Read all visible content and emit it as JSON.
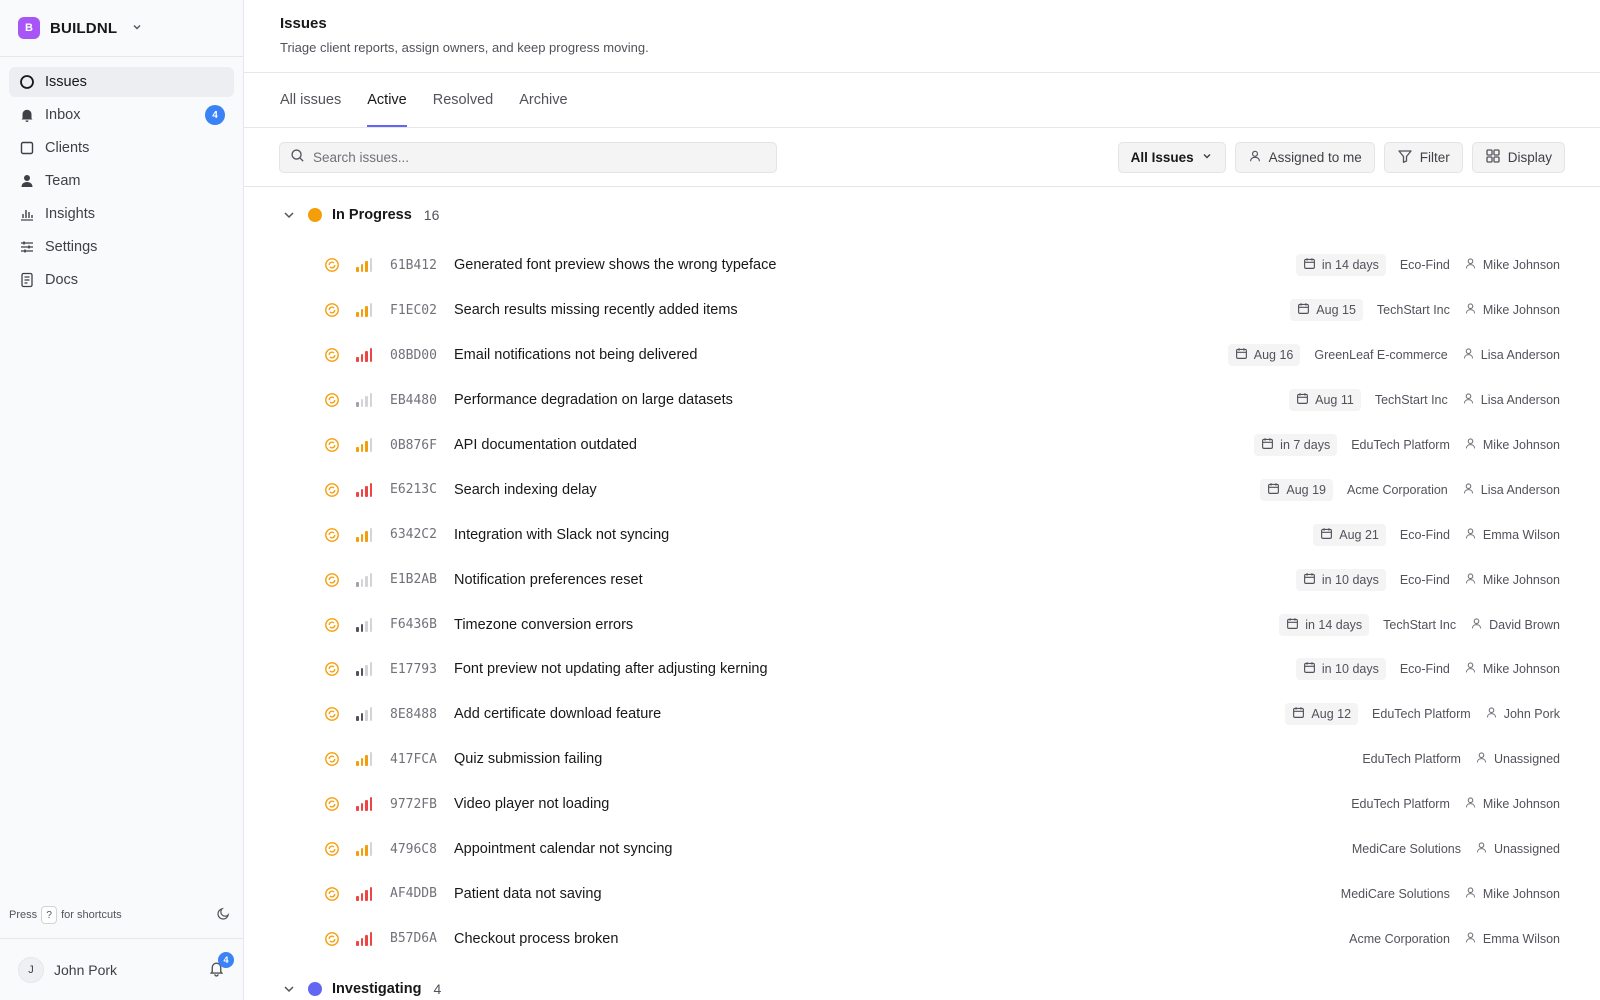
{
  "workspace": {
    "initial": "B",
    "name": "BUILDNL"
  },
  "nav": [
    {
      "label": "Issues",
      "icon": "circle-icon",
      "active": true
    },
    {
      "label": "Inbox",
      "icon": "bell-icon",
      "badge": "4"
    },
    {
      "label": "Clients",
      "icon": "square-icon"
    },
    {
      "label": "Team",
      "icon": "person-icon"
    },
    {
      "label": "Insights",
      "icon": "bar-chart-icon"
    },
    {
      "label": "Settings",
      "icon": "sliders-icon"
    },
    {
      "label": "Docs",
      "icon": "document-icon"
    }
  ],
  "shortcut": {
    "press": "Press",
    "key": "?",
    "suffix": "for shortcuts"
  },
  "user": {
    "initial": "J",
    "name": "John Pork",
    "notifications": "4"
  },
  "header": {
    "title": "Issues",
    "subtitle": "Triage client reports, assign owners, and keep progress moving."
  },
  "tabs": [
    {
      "label": "All issues"
    },
    {
      "label": "Active",
      "active": true
    },
    {
      "label": "Resolved"
    },
    {
      "label": "Archive"
    }
  ],
  "toolbar": {
    "search_placeholder": "Search issues...",
    "view_select": "All Issues",
    "assigned_label": "Assigned to me",
    "filter_label": "Filter",
    "display_label": "Display"
  },
  "colors": {
    "in_progress": "#f59e0b",
    "investigating": "#6366f1",
    "high": "#ef4444",
    "medium": "#f59e0b",
    "low": "#a1a1aa"
  },
  "groups": [
    {
      "name": "In Progress",
      "count": "16",
      "color": "#f59e0b",
      "issues": [
        {
          "id": "61B412",
          "title": "Generated font preview shows the wrong typeface",
          "priority": "medium",
          "date": "in 14 days",
          "client": "Eco-Find",
          "assignee": "Mike Johnson"
        },
        {
          "id": "F1EC02",
          "title": "Search results missing recently added items",
          "priority": "medium",
          "date": "Aug 15",
          "client": "TechStart Inc",
          "assignee": "Mike Johnson"
        },
        {
          "id": "08BD00",
          "title": "Email notifications not being delivered",
          "priority": "high",
          "date": "Aug 16",
          "client": "GreenLeaf E-commerce",
          "assignee": "Lisa Anderson"
        },
        {
          "id": "EB4480",
          "title": "Performance degradation on large datasets",
          "priority": "low",
          "date": "Aug 11",
          "client": "TechStart Inc",
          "assignee": "Lisa Anderson"
        },
        {
          "id": "0B876F",
          "title": "API documentation outdated",
          "priority": "medium",
          "date": "in 7 days",
          "client": "EduTech Platform",
          "assignee": "Mike Johnson"
        },
        {
          "id": "E6213C",
          "title": "Search indexing delay",
          "priority": "high",
          "date": "Aug 19",
          "client": "Acme Corporation",
          "assignee": "Lisa Anderson"
        },
        {
          "id": "6342C2",
          "title": "Integration with Slack not syncing",
          "priority": "medium",
          "date": "Aug 21",
          "client": "Eco-Find",
          "assignee": "Emma Wilson"
        },
        {
          "id": "E1B2AB",
          "title": "Notification preferences reset",
          "priority": "low",
          "date": "in 10 days",
          "client": "Eco-Find",
          "assignee": "Mike Johnson"
        },
        {
          "id": "F6436B",
          "title": "Timezone conversion errors",
          "priority": "low-dark",
          "date": "in 14 days",
          "client": "TechStart Inc",
          "assignee": "David Brown"
        },
        {
          "id": "E17793",
          "title": "Font preview not updating after adjusting kerning",
          "priority": "low-dark",
          "date": "in 10 days",
          "client": "Eco-Find",
          "assignee": "Mike Johnson"
        },
        {
          "id": "8E8488",
          "title": "Add certificate download feature",
          "priority": "low-dark",
          "date": "Aug 12",
          "client": "EduTech Platform",
          "assignee": "John Pork"
        },
        {
          "id": "417FCA",
          "title": "Quiz submission failing",
          "priority": "medium",
          "date": "",
          "client": "EduTech Platform",
          "assignee": "Unassigned"
        },
        {
          "id": "9772FB",
          "title": "Video player not loading",
          "priority": "high",
          "date": "",
          "client": "EduTech Platform",
          "assignee": "Mike Johnson"
        },
        {
          "id": "4796C8",
          "title": "Appointment calendar not syncing",
          "priority": "medium",
          "date": "",
          "client": "MediCare Solutions",
          "assignee": "Unassigned"
        },
        {
          "id": "AF4DDB",
          "title": "Patient data not saving",
          "priority": "high",
          "date": "",
          "client": "MediCare Solutions",
          "assignee": "Mike Johnson"
        },
        {
          "id": "B57D6A",
          "title": "Checkout process broken",
          "priority": "high",
          "date": "",
          "client": "Acme Corporation",
          "assignee": "Emma Wilson"
        }
      ]
    },
    {
      "name": "Investigating",
      "count": "4",
      "color": "#6366f1",
      "issues": []
    }
  ]
}
